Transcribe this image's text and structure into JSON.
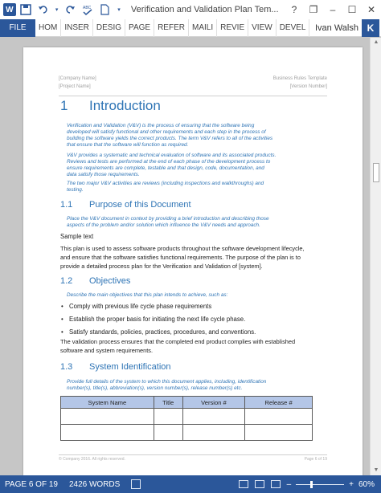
{
  "titlebar": {
    "app_icon": "W",
    "title": "Verification and Validation Plan Tem...",
    "help": "?",
    "restore": "❐",
    "minimize": "–",
    "maximize": "☐",
    "close": "✕"
  },
  "ribbon": {
    "file": "FILE",
    "tabs": [
      "HOM",
      "INSER",
      "DESIG",
      "PAGE",
      "REFER",
      "MAILI",
      "REVIE",
      "VIEW",
      "DEVEL"
    ],
    "user_name": "Ivan Walsh",
    "avatar_letter": "K"
  },
  "document": {
    "header": {
      "company": "[Company Name]",
      "template": "Business Rules Template",
      "project": "[Project Name]",
      "version": "[Version Number]"
    },
    "section1": {
      "num": "1",
      "title": "Introduction",
      "guide_lines": [
        "Verification and Validation (V&V) is the process of ensuring that the software being",
        "developed will satisfy functional and other requirements and each step in the process of",
        "building the software yields the correct products. The term V&V refers to all of the activities",
        "that ensure that the software will function as required."
      ],
      "guide2_lines": [
        "V&V provides a systematic and technical evaluation of software and its associated products.",
        "Reviews and tests are performed at the end of each phase of the development process to",
        "ensure requirements are complete, testable and that design, code, documentation, and",
        "data satisfy those requirements."
      ],
      "guide3_lines": [
        "The two major V&V activities are reviews (including inspections and walkthroughs) and",
        "testing."
      ]
    },
    "section1_1": {
      "num": "1.1",
      "title": "Purpose of this Document",
      "guide_lines": [
        "Place the V&V document in context by providing a brief introduction and describing those",
        "aspects of the problem and/or solution which influence the V&V needs and approach."
      ],
      "sample": "Sample text",
      "body_lines": [
        "This plan is used to assess software products throughout the software development lifecycle,",
        "and ensure that the software satisfies functional requirements. The purpose of the plan is to",
        "provide a detailed process plan for the Verification and Validation of [system]."
      ]
    },
    "section1_2": {
      "num": "1.2",
      "title": "Objectives",
      "guide": "Describe the main objectives that this plan intends to achieve, such as:",
      "bullets": [
        "Comply with previous life cycle phase requirements",
        "Establish the proper basis for initiating the next life cycle phase.",
        "Satisfy standards, policies, practices, procedures, and conventions."
      ],
      "body_lines": [
        "The validation process ensures that the completed end product complies with established",
        "software and system requirements."
      ]
    },
    "section1_3": {
      "num": "1.3",
      "title": "System Identification",
      "guide_lines": [
        "Provide full details of the system to which this document applies, including, identification",
        "number(s), title(s), abbreviation(s), version number(s), release number(s) etc."
      ],
      "table_headers": [
        "System Name",
        "Title",
        "Version #",
        "Release #"
      ]
    },
    "footer": {
      "copyright": "© Company 2016. All rights reserved.",
      "page": "Page 6 of 19"
    }
  },
  "statusbar": {
    "page": "PAGE 6 OF 19",
    "words": "2426 WORDS",
    "zoom": "60%",
    "zoom_level_percent": 60
  }
}
